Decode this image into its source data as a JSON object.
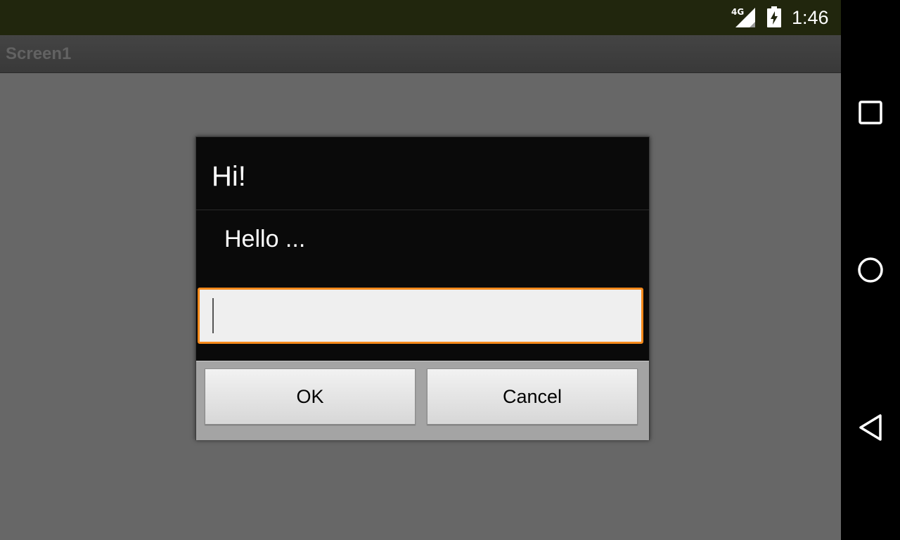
{
  "status_bar": {
    "network": "4G",
    "time": "1:46",
    "icons": [
      "signal-icon",
      "battery-charging-icon"
    ]
  },
  "app_bar": {
    "title": "Screen1"
  },
  "dialog": {
    "title": "Hi!",
    "message": "Hello ...",
    "input_value": "",
    "ok_label": "OK",
    "cancel_label": "Cancel"
  },
  "nav_bar": {
    "icons": [
      "recents-icon",
      "home-icon",
      "back-icon"
    ]
  },
  "colors": {
    "status_bar": "#21260d",
    "input_focus": "#f58a1c",
    "dialog_background": "#0a0a0a",
    "screen_background": "#676767"
  }
}
